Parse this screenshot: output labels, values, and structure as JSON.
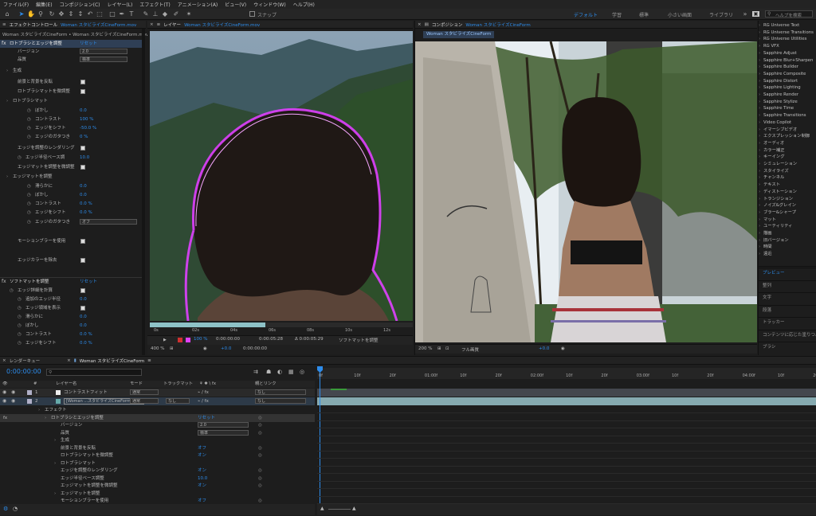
{
  "menu": [
    "ファイル(F)",
    "編集(E)",
    "コンポジション(C)",
    "レイヤー(L)",
    "エフェクト(T)",
    "アニメーション(A)",
    "ビュー(V)",
    "ウィンドウ(W)",
    "ヘルプ(H)"
  ],
  "toolbar": {
    "snap_label": "スナップ",
    "workspaces": [
      "デフォルト",
      "学習",
      "標準",
      "小さい画面",
      "ライブラリ"
    ],
    "search_placeholder": "ヘルプを検索"
  },
  "effect_controls": {
    "tab": "エフェクトコントロール",
    "tab_layer": "Woman スタビライズCineForm.mov",
    "breadcrumb": "Woman スタビライズCineForm • Woman スタビライズCineForm.mov",
    "fx1": "ロトブラシとエッジを調整",
    "reset": "リセット",
    "rows": [
      {
        "label": "バージョン",
        "value": "2.0"
      },
      {
        "label": "品質",
        "value": "標準"
      },
      {
        "label": "生成"
      },
      {
        "label": "前景と背景を反転"
      },
      {
        "label": "ロトブラシマットを微調整"
      },
      {
        "label": "ロトブラシマット"
      },
      {
        "label": "ぼかし",
        "value": "0.0"
      },
      {
        "label": "コントラスト",
        "value": "100 %"
      },
      {
        "label": "エッジをシフト",
        "value": "-50.0 %"
      },
      {
        "label": "エッジのガタつき",
        "value": "0 %"
      },
      {
        "label": "エッジを調整のレンダリング"
      },
      {
        "label": "エッジ半径ベース調",
        "value": "10.0"
      },
      {
        "label": "エッジマットを調整を微調整"
      },
      {
        "label": "エッジマットを調整"
      },
      {
        "label": "滑らかに",
        "value": "0.0"
      },
      {
        "label": "ぼかし",
        "value": "0.0"
      },
      {
        "label": "コントラスト",
        "value": "0.0 %"
      },
      {
        "label": "エッジをシフト",
        "value": "0.0 %"
      },
      {
        "label": "エッジのガタつき",
        "value": "オフ"
      },
      {
        "label": "モーションブラーを使用"
      },
      {
        "label": "エッジカラーを除去"
      }
    ],
    "fx2": "ソフトマットを調整",
    "fx2_reset": "リセット",
    "rows2": [
      {
        "label": "エッジ詳細を計算"
      },
      {
        "label": "追加のエッジ半径",
        "value": "0.0"
      },
      {
        "label": "エッジ領域を表示"
      },
      {
        "label": "滑らかに",
        "value": "0.0"
      },
      {
        "label": "ぼかし",
        "value": "0.0"
      },
      {
        "label": "コントラスト",
        "value": "0.0 %"
      },
      {
        "label": "エッジをシフト",
        "value": "0.0 %"
      }
    ]
  },
  "layer_viewer": {
    "tab": "レイヤー",
    "tab_name": "Woman スタビライズCineForm.mov",
    "ruler": [
      "0s",
      "02s",
      "04s",
      "06s",
      "08s",
      "10s",
      "12s"
    ],
    "zoom": "400 %",
    "time": "0:00:00:00",
    "time2": "0:00:05:28",
    "dur": "Δ 0:00:05:29",
    "view": "ソフトマットを調整",
    "pct": "100 %",
    "offset": "+0.0",
    "time3": "0:00:00:00"
  },
  "comp_viewer": {
    "tab": "コンポジション",
    "tab_name": "Woman スタビライズCineForm",
    "subtab": "Woman スタビライズCineForm",
    "zoom": "200 %",
    "res": "フル画質",
    "time": "0:00:00:00",
    "offset": "+0.0"
  },
  "effects_panel": {
    "items": [
      "RG Universe Text",
      "RG Universe Transitions",
      "RG Universe Utilities",
      "RG VFX",
      "Sapphire Adjust",
      "Sapphire Blur+Sharpen",
      "Sapphire Builder",
      "Sapphire Composite",
      "Sapphire Distort",
      "Sapphire Lighting",
      "Sapphire Render",
      "Sapphire Stylize",
      "Sapphire Time",
      "Sapphire Transitions",
      "Video Copilot",
      "イマーシブビデオ",
      "エクスプレッション制御",
      "オーディオ",
      "カラー補正",
      "キーイング",
      "シミュレーション",
      "スタイライズ",
      "チャンネル",
      "テキスト",
      "ディストーション",
      "トランジション",
      "ノイズ&グレイン",
      "ブラー&シャープ",
      "マット",
      "ユーティリティ",
      "描画",
      "旧バージョン",
      "時間",
      "遠近"
    ],
    "sections": [
      "プレビュー",
      "整列",
      "文字",
      "段落",
      "トラッカー",
      "コンテンツに応じた塗りつぶし",
      "ブラシ"
    ]
  },
  "timeline": {
    "render_queue": "レンダーキュー",
    "tab": "Woman スタビライズCineForm",
    "timecode": "0:00:00:00",
    "search_placeholder": "",
    "col_headers": {
      "num": "#",
      "name": "レイヤー名",
      "mode": "モード",
      "trk": "トラックマット",
      "parent": "親とリンク"
    },
    "layers": [
      {
        "num": "1",
        "name": "コントラストフィット",
        "mode": "通常",
        "parent": "なし"
      },
      {
        "num": "2",
        "name": "[Woman ...スタビライズCineForm.mov]",
        "mode": "通常",
        "trk": "なし",
        "parent": "なし"
      }
    ],
    "props": [
      {
        "label": "エフェクト",
        "indent": 0
      },
      {
        "label": "ロトブラシとエッジを調整",
        "indent": 1,
        "value": "リセット"
      },
      {
        "label": "バージョン",
        "indent": 2,
        "value": "2.0"
      },
      {
        "label": "品質",
        "indent": 2,
        "value": "標準"
      },
      {
        "label": "生成",
        "indent": 2
      },
      {
        "label": "前景と背景を反転",
        "indent": 2,
        "value": "オフ"
      },
      {
        "label": "ロトブラシマットを微調整",
        "indent": 2,
        "value": "オン"
      },
      {
        "label": "ロトブラシマット",
        "indent": 2
      },
      {
        "label": "エッジを調整のレンダリング",
        "indent": 2,
        "value": "オン"
      },
      {
        "label": "エッジ半径ベース調整",
        "indent": 2,
        "value": "10.0"
      },
      {
        "label": "エッジマットを調整を微調整",
        "indent": 2,
        "value": "オン"
      },
      {
        "label": "エッジマットを調整",
        "indent": 2
      },
      {
        "label": "モーションブラーを使用",
        "indent": 2,
        "value": "オフ"
      }
    ],
    "ruler": [
      "0f",
      "10f",
      "20f",
      "01:00f",
      "10f",
      "20f",
      "02:00f",
      "10f",
      "20f",
      "03:00f",
      "10f",
      "20f",
      "04:00f",
      "10f",
      "20f"
    ]
  },
  "colors": {
    "accent": "#2d8ceb",
    "rotobrush": "#e040ff"
  }
}
